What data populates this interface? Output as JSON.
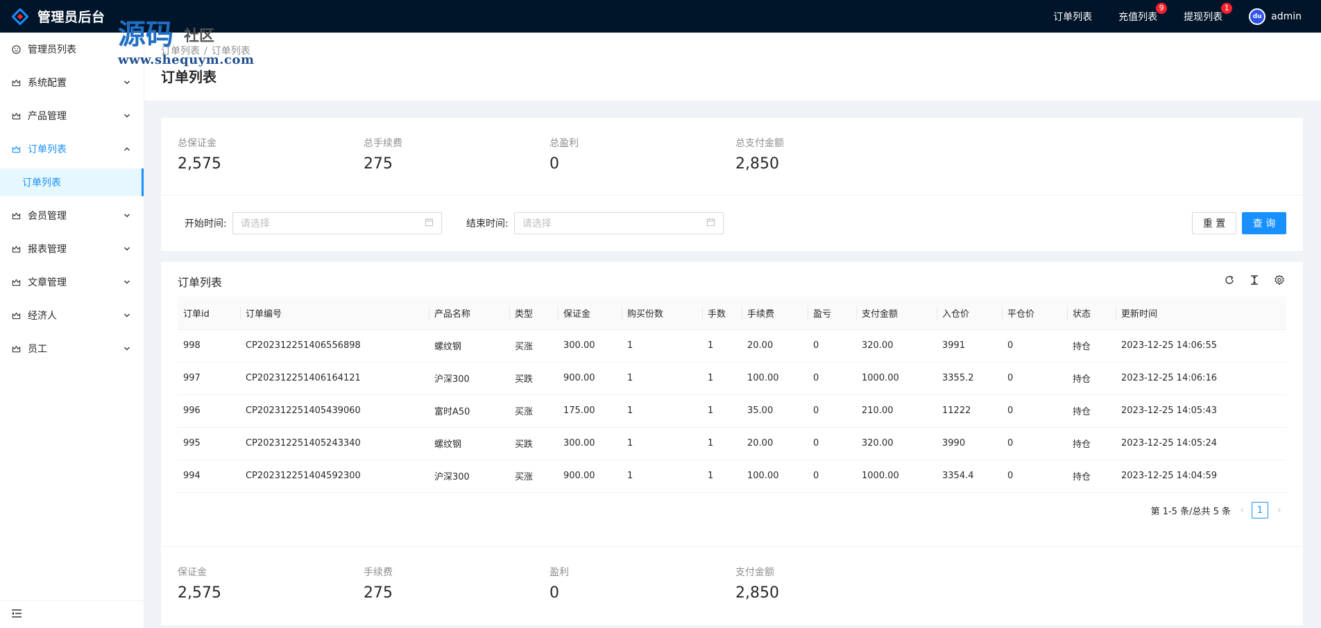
{
  "header": {
    "title": "管理员后台",
    "links": [
      {
        "label": "订单列表",
        "badge": ""
      },
      {
        "label": "充值列表",
        "badge": "9"
      },
      {
        "label": "提现列表",
        "badge": "1"
      }
    ],
    "avatar_text": "du",
    "user": "admin"
  },
  "watermark": {
    "big": "源码",
    "small": "社区",
    "url": "www.shequym.com"
  },
  "sidebar": {
    "items": [
      {
        "label": "管理员列表"
      },
      {
        "label": "系统配置"
      },
      {
        "label": "产品管理"
      },
      {
        "label": "订单列表"
      },
      {
        "label": "会员管理"
      },
      {
        "label": "报表管理"
      },
      {
        "label": "文章管理"
      },
      {
        "label": "经济人"
      },
      {
        "label": "员工"
      }
    ],
    "active_sub": "订单列表"
  },
  "page": {
    "breadcrumb": [
      "订单列表",
      "订单列表"
    ],
    "title": "订单列表"
  },
  "stats": [
    {
      "label": "总保证金",
      "value": "2,575"
    },
    {
      "label": "总手续费",
      "value": "275"
    },
    {
      "label": "总盈利",
      "value": "0"
    },
    {
      "label": "总支付金额",
      "value": "2,850"
    }
  ],
  "search": {
    "start_label": "开始时间:",
    "start_placeholder": "请选择",
    "end_label": "结束时间:",
    "end_placeholder": "请选择",
    "reset": "重 置",
    "query": "查 询"
  },
  "table": {
    "title": "订单列表",
    "columns": [
      "订单id",
      "订单编号",
      "产品名称",
      "类型",
      "保证金",
      "购买份数",
      "手数",
      "手续费",
      "盈亏",
      "支付金额",
      "入仓价",
      "平仓价",
      "状态",
      "更新时间"
    ],
    "rows": [
      [
        "998",
        "CP202312251406556898",
        "螺纹钢",
        "买涨",
        "300.00",
        "1",
        "1",
        "20.00",
        "0",
        "320.00",
        "3991",
        "0",
        "持仓",
        "2023-12-25 14:06:55"
      ],
      [
        "997",
        "CP202312251406164121",
        "沪深300",
        "买跌",
        "900.00",
        "1",
        "1",
        "100.00",
        "0",
        "1000.00",
        "3355.2",
        "0",
        "持仓",
        "2023-12-25 14:06:16"
      ],
      [
        "996",
        "CP202312251405439060",
        "富时A50",
        "买涨",
        "175.00",
        "1",
        "1",
        "35.00",
        "0",
        "210.00",
        "11222",
        "0",
        "持仓",
        "2023-12-25 14:05:43"
      ],
      [
        "995",
        "CP202312251405243340",
        "螺纹钢",
        "买跌",
        "300.00",
        "1",
        "1",
        "20.00",
        "0",
        "320.00",
        "3990",
        "0",
        "持仓",
        "2023-12-25 14:05:24"
      ],
      [
        "994",
        "CP202312251404592300",
        "沪深300",
        "买涨",
        "900.00",
        "1",
        "1",
        "100.00",
        "0",
        "1000.00",
        "3354.4",
        "0",
        "持仓",
        "2023-12-25 14:04:59"
      ]
    ],
    "pagination_text": "第 1-5 条/总共 5 条",
    "current_page": "1"
  },
  "summary": [
    {
      "label": "保证金",
      "value": "2,575"
    },
    {
      "label": "手续费",
      "value": "275"
    },
    {
      "label": "盈利",
      "value": "0"
    },
    {
      "label": "支付金额",
      "value": "2,850"
    }
  ],
  "colors": {
    "primary": "#1890ff",
    "header_bg": "#001529",
    "badge": "#f5222d"
  },
  "icons": [
    "smile-icon",
    "crown-icon",
    "chevron-down-icon",
    "chevron-up-icon",
    "calendar-icon",
    "reload-icon",
    "column-height-icon",
    "setting-icon",
    "menu-fold-icon"
  ]
}
